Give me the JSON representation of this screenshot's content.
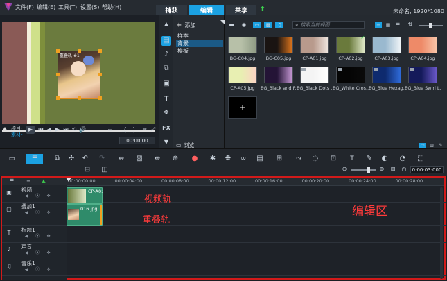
{
  "menu": [
    "文件(F)",
    "编辑(E)",
    "工具(T)",
    "设置(S)",
    "帮助(H)"
  ],
  "tabs": [
    "捕获",
    "编辑",
    "共享"
  ],
  "window_title": "未命名, 1920*1080",
  "preview": {
    "overlay_label": "重叠轨 #1",
    "project_label": "项目-",
    "clip_label": "素材-",
    "timecode": "00:00:00",
    "playhead_fraction": 0.0
  },
  "library": {
    "add_label": "添加",
    "folders": [
      "样本",
      "背景",
      "模板"
    ],
    "selected_folder": "背景",
    "browse_label": "浏览",
    "search_placeholder": "搜索当前视图",
    "items": [
      {
        "name": "BG-C04.jpg",
        "colors": [
          "#b7c0a8",
          "#8d9a84"
        ],
        "mark": false,
        "check": false
      },
      {
        "name": "BG-C05.jpg",
        "colors": [
          "#1a1412",
          "#e0761c"
        ],
        "mark": false,
        "check": false
      },
      {
        "name": "CP-A01.jpg",
        "colors": [
          "#b89a8c",
          "#efe6e0"
        ],
        "mark": false,
        "check": false
      },
      {
        "name": "CP-A02.jpg",
        "colors": [
          "#6a7a3c",
          "#dfe8c8"
        ],
        "mark": false,
        "check": true
      },
      {
        "name": "CP-A03.jpg",
        "colors": [
          "#9ab9cf",
          "#eef3f6"
        ],
        "mark": false,
        "check": false
      },
      {
        "name": "CP-A04.jpg",
        "colors": [
          "#ee8a68",
          "#f7c4a8"
        ],
        "mark": false,
        "check": false
      },
      {
        "name": "CP-A05.jpg",
        "colors": [
          "#e8efb2",
          "#fbd3c4"
        ],
        "mark": false,
        "check": false
      },
      {
        "name": "BG_Black and P...",
        "colors": [
          "#241436",
          "#c89ad6"
        ],
        "mark": false,
        "check": false
      },
      {
        "name": "BG_Black Dots ...",
        "colors": [
          "#f4f4f4",
          "#ffffff"
        ],
        "mark": true,
        "check": false
      },
      {
        "name": "BG_White Cros...",
        "colors": [
          "#050505",
          "#0a0a0a"
        ],
        "mark": true,
        "check": false
      },
      {
        "name": "BG_Blue Hexag...",
        "colors": [
          "#0e2a6e",
          "#2e6ad8"
        ],
        "mark": true,
        "check": false
      },
      {
        "name": "BG_Blue Swirl L...",
        "colors": [
          "#141a5a",
          "#6a58c8"
        ],
        "mark": true,
        "check": false
      }
    ],
    "add_item_label": "+"
  },
  "toolbar": {
    "timecode": "0:00:03:000"
  },
  "timeline": {
    "ruler": [
      "00:00:00:00",
      "00:00:04:00",
      "00:00:08:00",
      "00:00:12:00",
      "00:00:16:00",
      "00:00:20:00",
      "00:00:24:00",
      "00:00:28:00"
    ],
    "tracks": [
      "视频",
      "叠加1",
      "标题1",
      "声音",
      "音乐1"
    ],
    "clips": {
      "video": "CP-A0:",
      "overlay": "016.jpg"
    },
    "annotations": {
      "video_track": "视频轨",
      "overlay_track": "重叠轨",
      "edit_area": "编辑区"
    }
  },
  "colors": {
    "accent": "#1ba1e2",
    "annotation": "#ff3b3b",
    "clip_green": "#2f8b6a"
  }
}
